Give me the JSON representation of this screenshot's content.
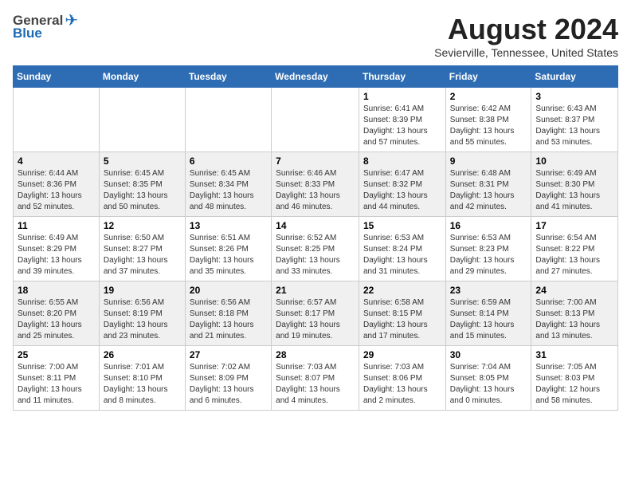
{
  "logo": {
    "general": "General",
    "blue": "Blue"
  },
  "title": "August 2024",
  "subtitle": "Sevierville, Tennessee, United States",
  "days_of_week": [
    "Sunday",
    "Monday",
    "Tuesday",
    "Wednesday",
    "Thursday",
    "Friday",
    "Saturday"
  ],
  "weeks": [
    [
      {
        "day": "",
        "info": ""
      },
      {
        "day": "",
        "info": ""
      },
      {
        "day": "",
        "info": ""
      },
      {
        "day": "",
        "info": ""
      },
      {
        "day": "1",
        "info": "Sunrise: 6:41 AM\nSunset: 8:39 PM\nDaylight: 13 hours\nand 57 minutes."
      },
      {
        "day": "2",
        "info": "Sunrise: 6:42 AM\nSunset: 8:38 PM\nDaylight: 13 hours\nand 55 minutes."
      },
      {
        "day": "3",
        "info": "Sunrise: 6:43 AM\nSunset: 8:37 PM\nDaylight: 13 hours\nand 53 minutes."
      }
    ],
    [
      {
        "day": "4",
        "info": "Sunrise: 6:44 AM\nSunset: 8:36 PM\nDaylight: 13 hours\nand 52 minutes."
      },
      {
        "day": "5",
        "info": "Sunrise: 6:45 AM\nSunset: 8:35 PM\nDaylight: 13 hours\nand 50 minutes."
      },
      {
        "day": "6",
        "info": "Sunrise: 6:45 AM\nSunset: 8:34 PM\nDaylight: 13 hours\nand 48 minutes."
      },
      {
        "day": "7",
        "info": "Sunrise: 6:46 AM\nSunset: 8:33 PM\nDaylight: 13 hours\nand 46 minutes."
      },
      {
        "day": "8",
        "info": "Sunrise: 6:47 AM\nSunset: 8:32 PM\nDaylight: 13 hours\nand 44 minutes."
      },
      {
        "day": "9",
        "info": "Sunrise: 6:48 AM\nSunset: 8:31 PM\nDaylight: 13 hours\nand 42 minutes."
      },
      {
        "day": "10",
        "info": "Sunrise: 6:49 AM\nSunset: 8:30 PM\nDaylight: 13 hours\nand 41 minutes."
      }
    ],
    [
      {
        "day": "11",
        "info": "Sunrise: 6:49 AM\nSunset: 8:29 PM\nDaylight: 13 hours\nand 39 minutes."
      },
      {
        "day": "12",
        "info": "Sunrise: 6:50 AM\nSunset: 8:27 PM\nDaylight: 13 hours\nand 37 minutes."
      },
      {
        "day": "13",
        "info": "Sunrise: 6:51 AM\nSunset: 8:26 PM\nDaylight: 13 hours\nand 35 minutes."
      },
      {
        "day": "14",
        "info": "Sunrise: 6:52 AM\nSunset: 8:25 PM\nDaylight: 13 hours\nand 33 minutes."
      },
      {
        "day": "15",
        "info": "Sunrise: 6:53 AM\nSunset: 8:24 PM\nDaylight: 13 hours\nand 31 minutes."
      },
      {
        "day": "16",
        "info": "Sunrise: 6:53 AM\nSunset: 8:23 PM\nDaylight: 13 hours\nand 29 minutes."
      },
      {
        "day": "17",
        "info": "Sunrise: 6:54 AM\nSunset: 8:22 PM\nDaylight: 13 hours\nand 27 minutes."
      }
    ],
    [
      {
        "day": "18",
        "info": "Sunrise: 6:55 AM\nSunset: 8:20 PM\nDaylight: 13 hours\nand 25 minutes."
      },
      {
        "day": "19",
        "info": "Sunrise: 6:56 AM\nSunset: 8:19 PM\nDaylight: 13 hours\nand 23 minutes."
      },
      {
        "day": "20",
        "info": "Sunrise: 6:56 AM\nSunset: 8:18 PM\nDaylight: 13 hours\nand 21 minutes."
      },
      {
        "day": "21",
        "info": "Sunrise: 6:57 AM\nSunset: 8:17 PM\nDaylight: 13 hours\nand 19 minutes."
      },
      {
        "day": "22",
        "info": "Sunrise: 6:58 AM\nSunset: 8:15 PM\nDaylight: 13 hours\nand 17 minutes."
      },
      {
        "day": "23",
        "info": "Sunrise: 6:59 AM\nSunset: 8:14 PM\nDaylight: 13 hours\nand 15 minutes."
      },
      {
        "day": "24",
        "info": "Sunrise: 7:00 AM\nSunset: 8:13 PM\nDaylight: 13 hours\nand 13 minutes."
      }
    ],
    [
      {
        "day": "25",
        "info": "Sunrise: 7:00 AM\nSunset: 8:11 PM\nDaylight: 13 hours\nand 11 minutes."
      },
      {
        "day": "26",
        "info": "Sunrise: 7:01 AM\nSunset: 8:10 PM\nDaylight: 13 hours\nand 8 minutes."
      },
      {
        "day": "27",
        "info": "Sunrise: 7:02 AM\nSunset: 8:09 PM\nDaylight: 13 hours\nand 6 minutes."
      },
      {
        "day": "28",
        "info": "Sunrise: 7:03 AM\nSunset: 8:07 PM\nDaylight: 13 hours\nand 4 minutes."
      },
      {
        "day": "29",
        "info": "Sunrise: 7:03 AM\nSunset: 8:06 PM\nDaylight: 13 hours\nand 2 minutes."
      },
      {
        "day": "30",
        "info": "Sunrise: 7:04 AM\nSunset: 8:05 PM\nDaylight: 13 hours\nand 0 minutes."
      },
      {
        "day": "31",
        "info": "Sunrise: 7:05 AM\nSunset: 8:03 PM\nDaylight: 12 hours\nand 58 minutes."
      }
    ]
  ]
}
